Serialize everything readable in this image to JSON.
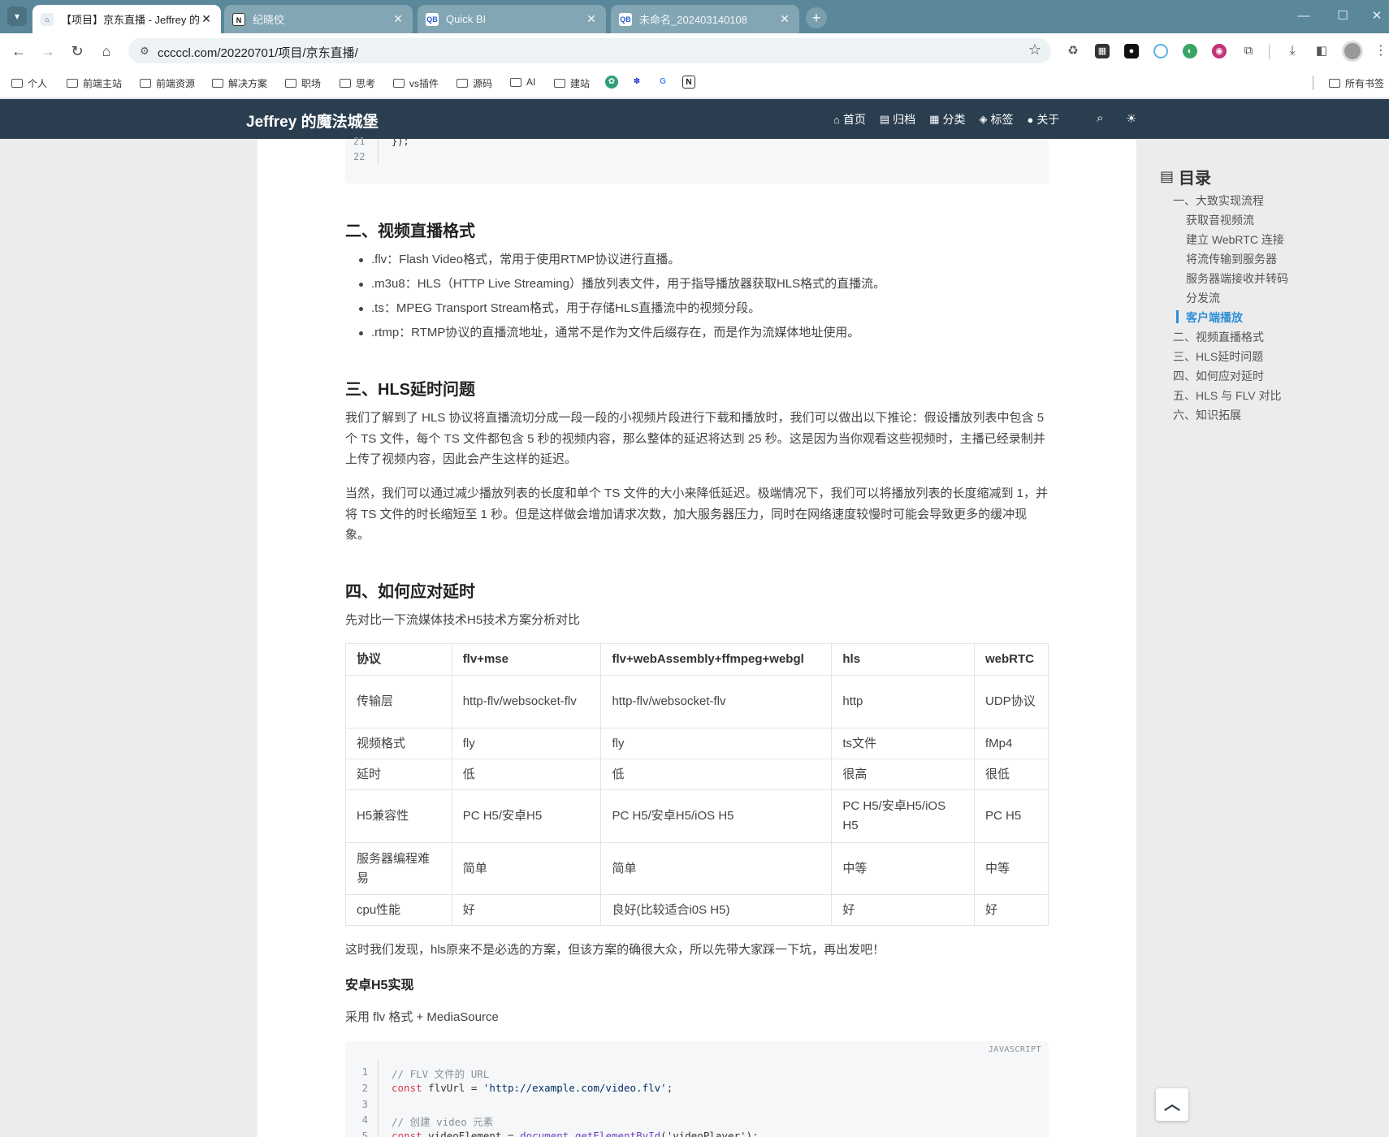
{
  "browser": {
    "tabs": [
      {
        "title": "【项目】京东直播 - Jeffrey 的魔法城堡",
        "favicon": "castle-icon",
        "active": true
      },
      {
        "title": "纪晓佼",
        "favicon": "notion-icon",
        "active": false
      },
      {
        "title": "Quick BI",
        "favicon": "quickbi-icon",
        "active": false
      },
      {
        "title": "未命名_202403140108",
        "favicon": "quickbi-icon",
        "active": false
      }
    ],
    "url": "cccccl.com/20220701/项目/京东直播/",
    "bookmarks": [
      "个人",
      "前端主站",
      "前端资源",
      "解决方案",
      "职场",
      "思考",
      "vs插件",
      "源码",
      "AI",
      "建站"
    ],
    "all_bookmarks": "所有书签"
  },
  "site": {
    "title": "Jeffrey 的魔法城堡",
    "nav": [
      {
        "label": "首页",
        "icon": "home-icon"
      },
      {
        "label": "归档",
        "icon": "archive-icon"
      },
      {
        "label": "分类",
        "icon": "category-icon"
      },
      {
        "label": "标签",
        "icon": "tag-icon"
      },
      {
        "label": "关于",
        "icon": "user-icon"
      }
    ]
  },
  "article": {
    "code_top_lines": [
      "21",
      "22"
    ],
    "code_top_text": "});",
    "h_video_format": "二、视频直播格式",
    "formats": [
      ".flv：Flash Video格式，常用于使用RTMP协议进行直播。",
      ".m3u8：HLS（HTTP Live Streaming）播放列表文件，用于指导播放器获取HLS格式的直播流。",
      ".ts：MPEG Transport Stream格式，用于存储HLS直播流中的视频分段。",
      ".rtmp：RTMP协议的直播流地址，通常不是作为文件后缀存在，而是作为流媒体地址使用。"
    ],
    "h_hls_delay": "三、HLS延时问题",
    "p_hls_1": "我们了解到了 HLS 协议将直播流切分成一段一段的小视频片段进行下载和播放时，我们可以做出以下推论：假设播放列表中包含 5 个 TS 文件，每个 TS 文件都包含 5 秒的视频内容，那么整体的延迟将达到 25 秒。这是因为当你观看这些视频时，主播已经录制并上传了视频内容，因此会产生这样的延迟。",
    "p_hls_2": "当然，我们可以通过减少播放列表的长度和单个 TS 文件的大小来降低延迟。极端情况下，我们可以将播放列表的长度缩减到 1，并将 TS 文件的时长缩短至 1 秒。但是这样做会增加请求次数，加大服务器压力，同时在网络速度较慢时可能会导致更多的缓冲现象。",
    "h_handle_delay": "四、如何应对延时",
    "p_compare": "先对比一下流媒体技术H5技术方案分析对比",
    "table": {
      "headers": [
        "协议",
        "flv+mse",
        "flv+webAssembly+ffmpeg+webgl",
        "hls",
        "webRTC"
      ],
      "rows": [
        [
          "传输层",
          "http-flv/websocket-flv",
          "http-flv/websocket-flv",
          "http",
          "UDP协议"
        ],
        [
          "视频格式",
          "fly",
          "fly",
          "ts文件",
          "fMp4"
        ],
        [
          "延时",
          "低",
          "低",
          "很高",
          "很低"
        ],
        [
          "H5兼容性",
          "PC H5/安卓H5",
          "PC H5/安卓H5/iOS H5",
          "PC H5/安卓H5/iOS H5",
          "PC H5"
        ],
        [
          "服务器编程难易",
          "简单",
          "简单",
          "中等",
          "中等"
        ],
        [
          "cpu性能",
          "好",
          "良好(比较适合i0S H5)",
          "好",
          "好"
        ]
      ]
    },
    "p_conclusion": "这时我们发现，hls原来不是必选的方案，但该方案的确很大众，所以先带大家踩一下坑，再出发吧！",
    "h_android": "安卓H5实现",
    "p_android": "采用 flv 格式 + MediaSource",
    "code_lang": "JAVASCRIPT",
    "code_line_numbers": [
      "1",
      "2",
      "3",
      "4",
      "5"
    ],
    "code_comment_1": "// FLV 文件的 URL",
    "code_kw_const": "const",
    "code_flv_var": " flvUrl = ",
    "code_flv_str": "'http://example.com/video.flv'",
    "code_semicolon": ";",
    "code_comment_2": "// 创建 video 元素",
    "code_video_var": " videoElement = ",
    "code_document": "document",
    "code_dot": ".",
    "code_get_by_id": "getElementById",
    "code_video_arg": "('videoPlayer');"
  },
  "toc": {
    "title": "目录",
    "items": [
      {
        "label": "一、大致实现流程",
        "level": 1
      },
      {
        "label": "获取音视频流",
        "level": 2
      },
      {
        "label": "建立 WebRTC 连接",
        "level": 2
      },
      {
        "label": "将流传输到服务器",
        "level": 2
      },
      {
        "label": "服务器端接收并转码",
        "level": 2
      },
      {
        "label": "分发流",
        "level": 2
      },
      {
        "label": "客户端播放",
        "level": 2,
        "active": true
      },
      {
        "label": "二、视频直播格式",
        "level": 1
      },
      {
        "label": "三、HLS延时问题",
        "level": 1
      },
      {
        "label": "四、如何应对延时",
        "level": 1
      },
      {
        "label": "五、HLS 与 FLV 对比",
        "level": 1
      },
      {
        "label": "六、知识拓展",
        "level": 1
      }
    ]
  },
  "colors": {
    "header_bg": "#2a3e50",
    "tab_strip": "#5a8799",
    "accent": "#2f8ed6"
  }
}
